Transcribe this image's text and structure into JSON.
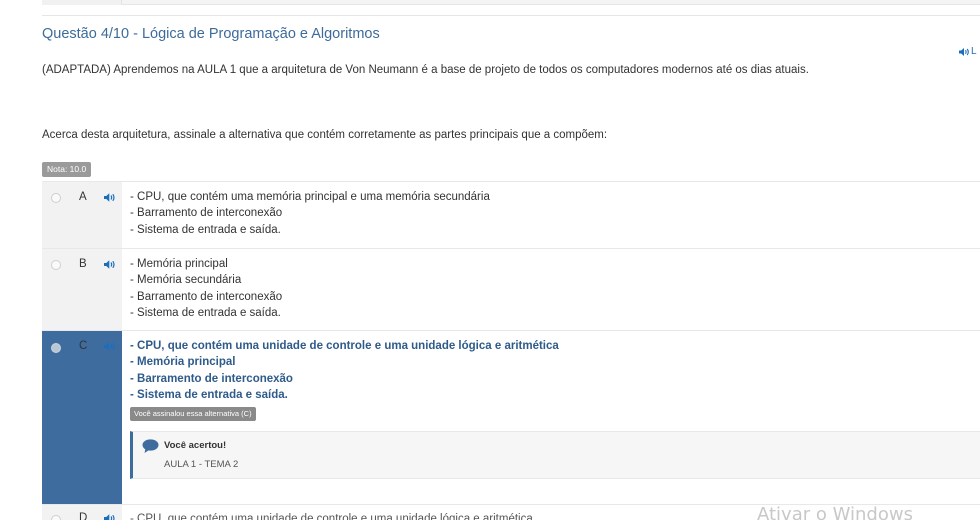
{
  "question": {
    "title": "Questão 4/10 - Lógica de Programação e Algoritmos",
    "listen_label": "L",
    "statement": "(ADAPTADA) Aprendemos na AULA 1 que a arquitetura de Von Neumann é a base de projeto de todos os computadores modernos até os dias atuais.",
    "prompt": "Acerca desta arquitetura, assinale a alternativa que contém corretamente as partes principais que a compõem:",
    "grade": "Nota: 10.0"
  },
  "options": [
    {
      "letter": "A",
      "lines": [
        "- CPU, que contém uma memória principal e uma memória secundária",
        "- Barramento de interconexão",
        "- Sistema de entrada e saída."
      ]
    },
    {
      "letter": "B",
      "lines": [
        "- Memória principal",
        "- Memória secundária",
        "- Barramento de interconexão",
        "- Sistema de entrada e saída."
      ]
    },
    {
      "letter": "C",
      "selected": true,
      "lines": [
        "- CPU, que contém uma unidade de controle e uma unidade lógica e aritmética",
        "- Memória principal",
        "- Barramento de interconexão",
        "- Sistema de entrada e saída."
      ],
      "selected_badge": "Você assinalou essa alternativa (C)",
      "feedback": {
        "title": "Você acertou!",
        "text": "AULA 1 - TEMA 2"
      }
    },
    {
      "letter": "D",
      "lines": [
        "- CPU, que contém uma unidade de controle e uma unidade lógica e aritmética"
      ]
    }
  ],
  "icons": {
    "audio": "speaker-icon",
    "feedback": "comment-icon",
    "radio": "radio-button"
  },
  "colors": {
    "accent": "#3f6c9e",
    "title": "#3d6b9a",
    "audio": "#1a6fbd",
    "correct_text": "#2e5b8a"
  },
  "watermark": "Ativar o Windows"
}
